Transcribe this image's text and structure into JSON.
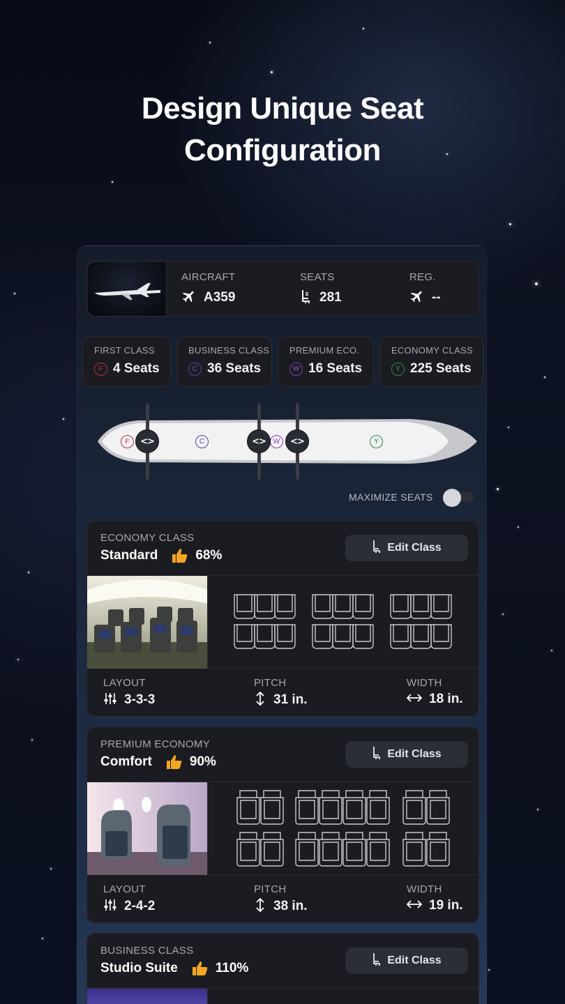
{
  "hero": {
    "title_line1": "Design Unique Seat",
    "title_line2": "Configuration"
  },
  "aircraft": {
    "aircraft_label": "AIRCRAFT",
    "aircraft_value": "A359",
    "seats_label": "SEATS",
    "seats_value": "281",
    "reg_label": "REG.",
    "reg_value": "--"
  },
  "classes": [
    {
      "label": "FIRST CLASS",
      "code": "F",
      "seats": "4 Seats",
      "color": "#c0303a"
    },
    {
      "label": "BUSINESS CLASS",
      "code": "C",
      "seats": "36 Seats",
      "color": "#4b47a8"
    },
    {
      "label": "PREMIUM ECO.",
      "code": "W",
      "seats": "16 Seats",
      "color": "#8a3db0"
    },
    {
      "label": "ECONOMY CLASS",
      "code": "Y",
      "seats": "225 Seats",
      "color": "#2e8c45"
    }
  ],
  "fuselage": {
    "zones": [
      "F",
      "C",
      "W",
      "Y"
    ],
    "handle_glyph": "<>"
  },
  "maximize": {
    "label": "MAXIMIZE SEATS",
    "enabled": false
  },
  "cards": [
    {
      "category": "ECONOMY CLASS",
      "name": "Standard",
      "rating": "68%",
      "edit_label": "Edit Class",
      "layout_label": "LAYOUT",
      "layout_value": "3-3-3",
      "pitch_label": "PITCH",
      "pitch_value": "31 in.",
      "width_label": "WIDTH",
      "width_value": "18 in."
    },
    {
      "category": "PREMIUM ECONOMY",
      "name": "Comfort",
      "rating": "90%",
      "edit_label": "Edit Class",
      "layout_label": "LAYOUT",
      "layout_value": "2-4-2",
      "pitch_label": "PITCH",
      "pitch_value": "38 in.",
      "width_label": "WIDTH",
      "width_value": "19 in."
    },
    {
      "category": "BUSINESS CLASS",
      "name": "Studio Suite",
      "rating": "110%",
      "edit_label": "Edit Class"
    }
  ],
  "colors": {
    "thumb": "#f5a623",
    "background": "#0b0f1d",
    "card": "#1b1c21"
  }
}
